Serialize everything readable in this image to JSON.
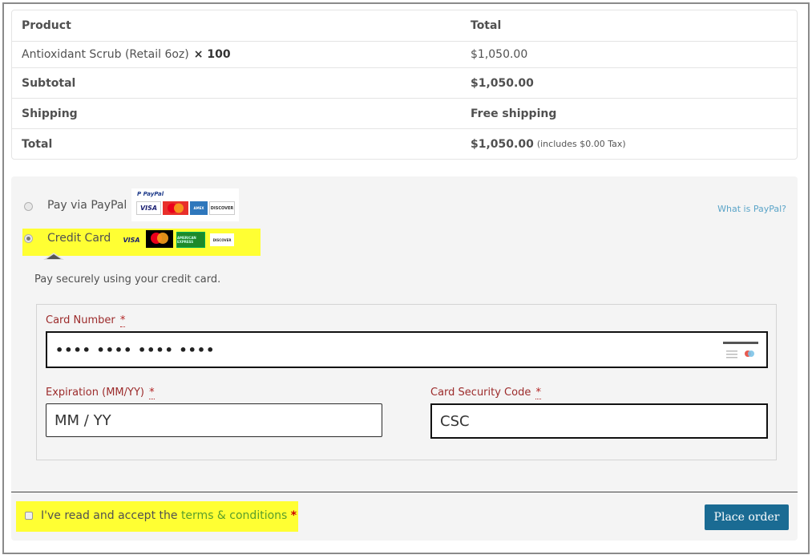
{
  "order_table": {
    "headers": [
      "Product",
      "Total"
    ],
    "item": {
      "name": "Antioxidant Scrub (Retail 6oz)",
      "qty": "× 100",
      "total": "$1,050.00"
    },
    "subtotal": {
      "label": "Subtotal",
      "value": "$1,050.00"
    },
    "shipping": {
      "label": "Shipping",
      "value": "Free shipping"
    },
    "total": {
      "label": "Total",
      "value": "$1,050.00",
      "note": "(includes $0.00 Tax)"
    }
  },
  "payment": {
    "paypal": {
      "label": "Pay via PayPal",
      "logo_text": "PayPal",
      "selected": false,
      "what_is": "What is PayPal?"
    },
    "credit_card": {
      "label": "Credit Card",
      "selected": true
    },
    "card_brands": [
      "VISA",
      "MasterCard",
      "AMERICAN EXPRESS",
      "DISCOVER"
    ],
    "description": "Pay securely using your credit card.",
    "fields": {
      "card_number": {
        "label": "Card Number",
        "required": "*",
        "value": "•••• •••• •••• ••••"
      },
      "expiration": {
        "label": "Expiration (MM/YY)",
        "required": "*",
        "placeholder": "MM / YY"
      },
      "csc": {
        "label": "Card Security Code",
        "required": "*",
        "placeholder": "CSC"
      }
    }
  },
  "terms": {
    "prefix": "I've read and accept the ",
    "link": "terms & conditions",
    "required": "*",
    "checked": false
  },
  "place_order": {
    "label": "Place order"
  },
  "colors": {
    "highlight": "#ffff33",
    "button": "#1a6b93",
    "link_green": "#5a9e2b",
    "link_blue": "#5aa4c8",
    "required_red": "#b22222"
  }
}
